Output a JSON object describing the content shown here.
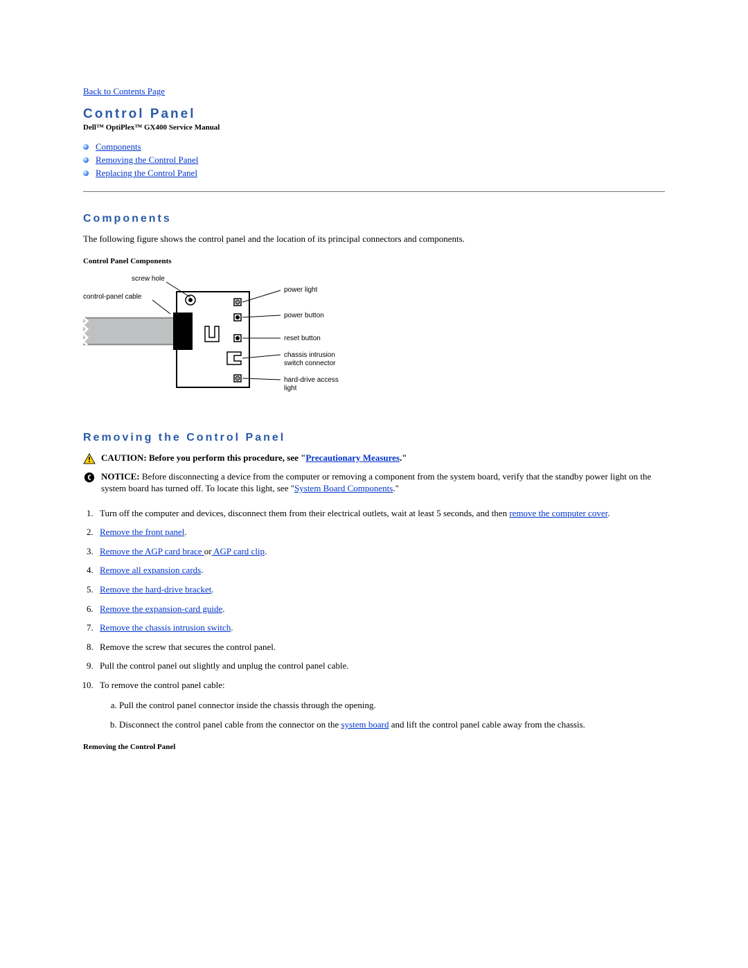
{
  "nav": {
    "back_link": "Back to Contents Page"
  },
  "header": {
    "title": "Control Panel",
    "subtitle": "Dell™ OptiPlex™ GX400 Service Manual"
  },
  "toc": {
    "items": [
      {
        "label": "Components"
      },
      {
        "label": "Removing the Control Panel"
      },
      {
        "label": "Replacing the Control Panel"
      }
    ]
  },
  "components": {
    "heading": "Components",
    "intro": "The following figure shows the control panel and the location of its principal connectors and components.",
    "figure_title": "Control Panel Components",
    "labels": {
      "screw_hole": "screw hole",
      "control_panel_cable": "control-panel cable",
      "power_light": "power light",
      "power_button": "power button",
      "reset_button": "reset button",
      "chassis_intrusion": "chassis intrusion",
      "switch_connector": "switch connector",
      "hard_drive_access": "hard-drive access",
      "light": "light"
    }
  },
  "removing": {
    "heading": "Removing the Control Panel",
    "caution_prefix": "CAUTION: Before you perform this procedure, see \"",
    "caution_link": "Precautionary Measures",
    "caution_suffix": ".\"",
    "notice_prefix": "NOTICE:",
    "notice_body_1": " Before disconnecting a device from the computer or removing a component from the system board, verify that the standby power light on the system board has turned off. To locate this light, see \"",
    "notice_link": "System Board Components",
    "notice_body_2": ".\"",
    "steps": {
      "s1_pre": "Turn off the computer and devices, disconnect them from their electrical outlets, wait at least 5 seconds, and then ",
      "s1_link": "remove the computer cover",
      "s1_post": ".",
      "s2_link": "Remove the front panel",
      "s2_post": ".",
      "s3_link1": "Remove the AGP card brace ",
      "s3_mid": "or",
      "s3_link2": " AGP card clip",
      "s3_post": ".",
      "s4_link": "Remove all expansion cards",
      "s4_post": ".",
      "s5_link": "Remove the hard-drive bracket",
      "s5_post": ".",
      "s6_link": "Remove the expansion-card guide",
      "s6_post": ".",
      "s7_link": "Remove the chassis intrusion switch",
      "s7_post": ".",
      "s8": "Remove the screw that secures the control panel.",
      "s9": "Pull the control panel out slightly and unplug the control panel cable.",
      "s10": "To remove the control panel cable:",
      "s10a": "Pull the control panel connector inside the chassis through the opening.",
      "s10b_pre": "Disconnect the control panel cable from the connector on the ",
      "s10b_link": "system board",
      "s10b_post": " and lift the control panel cable away from the chassis."
    },
    "figure_title": "Removing the Control Panel"
  }
}
